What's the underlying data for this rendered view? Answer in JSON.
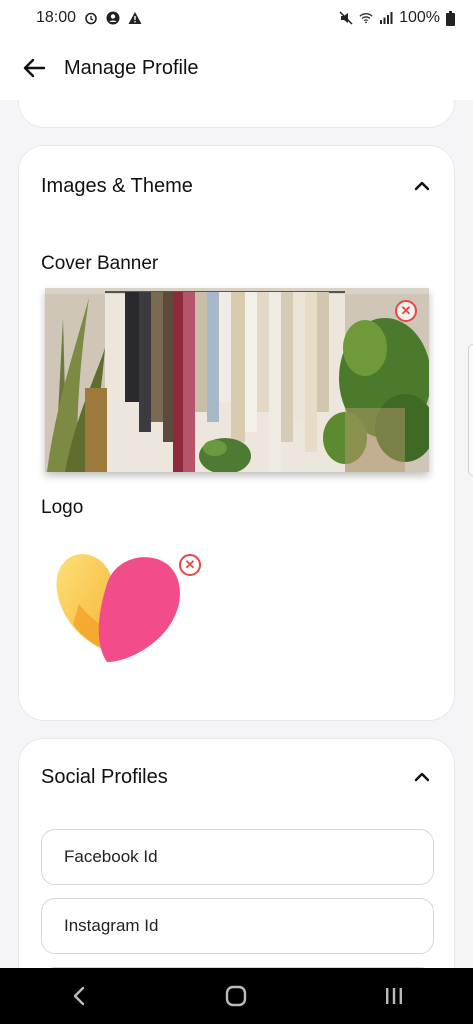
{
  "status_bar": {
    "time": "18:00",
    "battery": "100%",
    "icons": [
      "alarm-icon",
      "account-icon",
      "warning-icon",
      "mute-icon",
      "wifi-icon",
      "signal-icon",
      "battery-icon"
    ]
  },
  "header": {
    "title": "Manage Profile",
    "back_icon": "arrow-left-icon"
  },
  "images_section": {
    "title": "Images & Theme",
    "expanded": true,
    "cover_banner_label": "Cover Banner",
    "logo_label": "Logo"
  },
  "social_section": {
    "title": "Social Profiles",
    "expanded": true,
    "fields": [
      {
        "placeholder": "Facebook Id"
      },
      {
        "placeholder": "Instagram Id"
      }
    ]
  },
  "nav": {
    "back": "back-icon",
    "home": "home-icon",
    "recents": "recents-icon"
  },
  "colors": {
    "remove_badge": "#e54848",
    "heart_pink": "#f24d8a",
    "heart_yellow": "#fcd36a"
  }
}
